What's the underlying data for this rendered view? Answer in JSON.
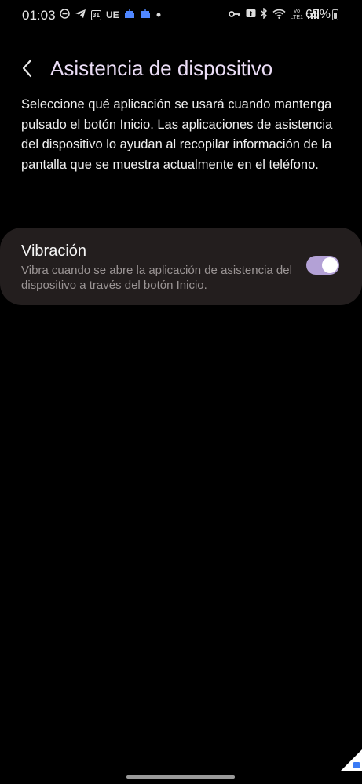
{
  "status_bar": {
    "time": "01:03",
    "left_icons": [
      "dnd-icon",
      "telegram-icon",
      "calendar-icon",
      "ue-icon",
      "cake-icon",
      "cake-icon",
      "dot-icon"
    ],
    "calendar_day": "31",
    "ue_label": "UE",
    "network_label_top": "Vo",
    "network_label_bottom": "LTE1",
    "battery_pct": "65%",
    "battery_level": 0.65
  },
  "header": {
    "title": "Asistencia de dispositivo"
  },
  "description": "Seleccione qué aplicación se usará cuando mantenga pulsado el botón Inicio. Las aplicaciones de asistencia del dispositivo lo ayudan al recopilar información de la pantalla que se muestra actualmente en el teléfono.",
  "vibration": {
    "title": "Vibración",
    "subtitle": "Vibra cuando se abre la aplicación de asistencia del dispositivo a través del botón Inicio.",
    "enabled": true
  },
  "colors": {
    "title": "#eadcf5",
    "card_bg": "#231e1e",
    "toggle_on": "#b3a1d6",
    "badge_blue": "#4f86ff"
  }
}
